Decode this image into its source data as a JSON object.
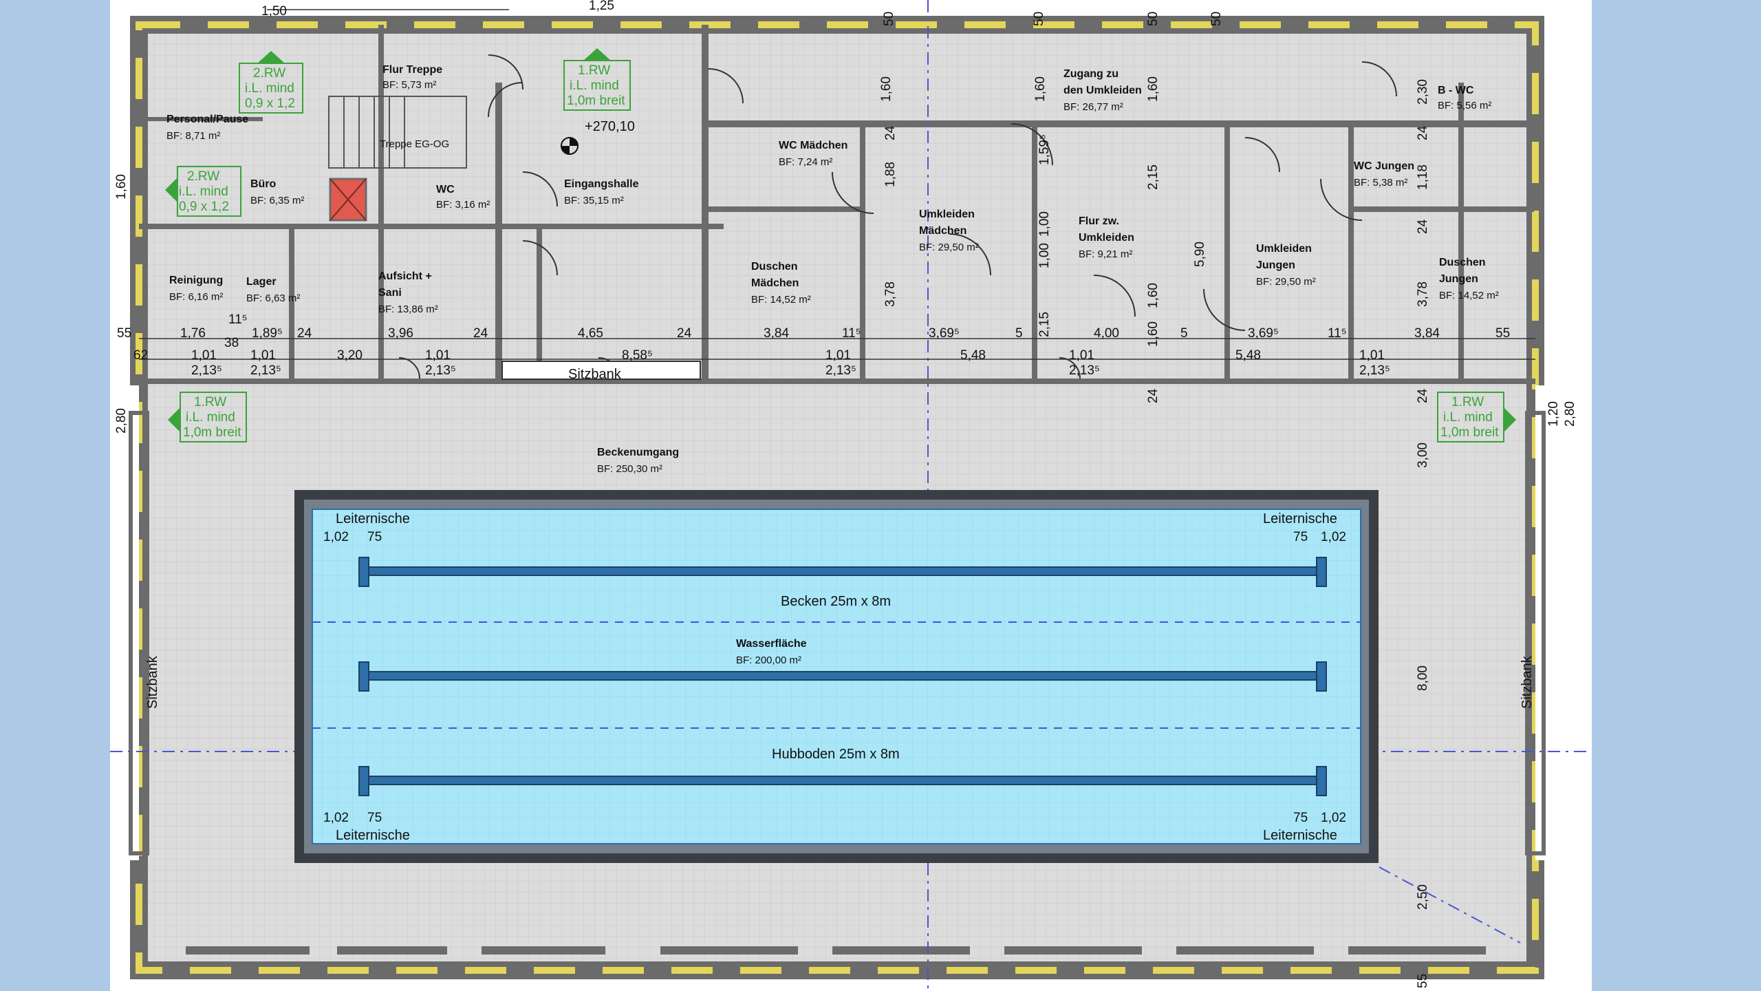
{
  "colors": {
    "frame_background": "#aec9e6",
    "drawing_background": "#ffffff",
    "room_fill": "#dcdcdc",
    "wall": "#6b6b6b",
    "insulation": "#e3d65a",
    "pool_water": "#a9e6f8",
    "pool_edge": "#3a3f46",
    "lane_rope": "#2e6fa8",
    "escape_route": "#3aa33a",
    "stair_shaft": "#e05a50",
    "axis_line": "#4a54d6"
  },
  "rooms": [
    {
      "name": "Personal/Pause",
      "area": "BF:       8,71 m²"
    },
    {
      "name": "Flur Treppe",
      "area": "BF:  5,73 m²"
    },
    {
      "name": "Büro",
      "area": "BF: 6,35 m²"
    },
    {
      "name": "WC",
      "area": "BF: 3,16 m²"
    },
    {
      "name": "Eingangshalle",
      "area": "BF:     35,15 m²"
    },
    {
      "name": "Reinigung",
      "area": "BF: 6,16 m²"
    },
    {
      "name": "Lager",
      "area": "BF: 6,63 m²"
    },
    {
      "name": "Aufsicht +",
      "name2": "Sani",
      "area": "BF: 13,86 m²"
    },
    {
      "name": "WC Mädchen",
      "area": "BF:     7,24 m²"
    },
    {
      "name": "Duschen",
      "name2": "Mädchen",
      "area": "BF: 14,52 m²"
    },
    {
      "name": "Umkleiden",
      "name2": "Mädchen",
      "area": "BF: 29,50 m²"
    },
    {
      "name": "Zugang zu",
      "name2": "den Umkleiden",
      "area": "BF:      26,77 m²"
    },
    {
      "name": "Flur zw.",
      "name2": "Umkleiden",
      "area": "BF: 9,21 m²"
    },
    {
      "name": "Umkleiden",
      "name2": "Jungen",
      "area": "BF: 29,50 m²"
    },
    {
      "name": "WC Jungen",
      "area": "BF: 5,38 m²"
    },
    {
      "name": "B - WC",
      "area": "BF: 5,56 m²"
    },
    {
      "name": "Duschen",
      "name2": "Jungen",
      "area": "BF: 14,52 m²"
    },
    {
      "name": "Beckenumgang",
      "area": "BF:    250,30 m²"
    }
  ],
  "pool": {
    "basin": "Becken 25m x 8m",
    "water_title": "Wasserfläche",
    "water_area": "BF: 200,00 m²",
    "lift_floor": "Hubboden 25m x 8m",
    "ladder_niche": "Leiternische",
    "niche_dims": [
      "1,02",
      "75"
    ]
  },
  "escape_routes": [
    {
      "line1": "2.RW",
      "line2": "i.L. mind",
      "line3": "0,9 x 1,2"
    },
    {
      "line1": "1.RW",
      "line2": "i.L. mind",
      "line3": "1,0m breit"
    }
  ],
  "level_mark": "+270,10",
  "stair_note": "Treppe EG-OG",
  "bench_label": "Sitzbank",
  "dimensions": {
    "top": [
      "1,50",
      "1,25",
      "50",
      "50",
      "50",
      "50"
    ],
    "row": [
      "55",
      "1,76",
      "1,89⁵",
      "24",
      "3,96",
      "24",
      "4,65",
      "24",
      "3,84",
      "11⁵",
      "3,69⁵",
      "5",
      "4,00",
      "5",
      "3,69⁵",
      "11⁵",
      "3,84",
      "55"
    ],
    "row2": [
      "62",
      "1,01",
      "2,13⁵",
      "1,01",
      "2,13⁵",
      "3,20",
      "1,01",
      "2,13⁵",
      "8,58⁵",
      "1,01",
      "2,13⁵",
      "5,48",
      "1,01",
      "2,13⁵",
      "5,48",
      "1,01",
      "2,13⁵"
    ],
    "vertical": [
      "1,60",
      "1,60",
      "1,60",
      "1,60",
      "2,30",
      "24",
      "1,18",
      "24",
      "3,78",
      "3,78",
      "1,88",
      "24",
      "2,15",
      "5,90",
      "1,60",
      "1,60",
      "2,15",
      "3,00",
      "8,00",
      "2,50",
      "2,80",
      "1,20",
      "2,80",
      "24",
      "55",
      "1,59⁵",
      "1,00",
      "1,00",
      "24",
      "11⁵",
      "38"
    ]
  }
}
